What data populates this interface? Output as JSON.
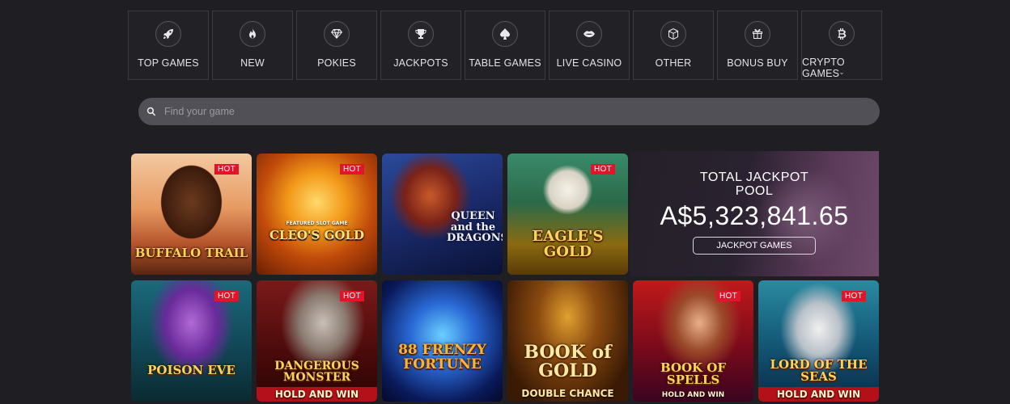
{
  "categories": [
    {
      "label": "TOP GAMES",
      "icon": "rocket-icon"
    },
    {
      "label": "NEW",
      "icon": "flame-icon"
    },
    {
      "label": "POKIES",
      "icon": "diamond-icon"
    },
    {
      "label": "JACKPOTS",
      "icon": "trophy-icon"
    },
    {
      "label": "TABLE GAMES",
      "icon": "spade-icon"
    },
    {
      "label": "LIVE CASINO",
      "icon": "lips-icon"
    },
    {
      "label": "OTHER",
      "icon": "cube-icon"
    },
    {
      "label": "BONUS BUY",
      "icon": "gift-icon"
    },
    {
      "label": "CRYPTO GAMES",
      "icon": "bitcoin-icon",
      "chevron": "⌄"
    }
  ],
  "search": {
    "placeholder": "Find your game"
  },
  "games": [
    {
      "title": "BUFFALO TRAIL",
      "subtitle": "",
      "hot": "HOT"
    },
    {
      "title": "CLEO'S GOLD",
      "subtitle": "FEATURED SLOT GAME",
      "hot": "HOT"
    },
    {
      "title": "QUEEN and the DRAGONS",
      "subtitle": "",
      "hot": ""
    },
    {
      "title": "EAGLE'S GOLD",
      "subtitle": "",
      "hot": "HOT"
    },
    {
      "title": "POISON EVE",
      "subtitle": "",
      "hot": "HOT"
    },
    {
      "title": "DANGEROUS MONSTER",
      "subtitle": "HOLD AND WIN",
      "hot": "HOT"
    },
    {
      "title": "88 FRENZY FORTUNE",
      "subtitle": "",
      "hot": ""
    },
    {
      "title": "BOOK of GOLD",
      "subtitle": "DOUBLE CHANCE",
      "hot": ""
    },
    {
      "title": "BOOK OF SPELLS",
      "subtitle": "HOLD AND WIN",
      "hot": "HOT"
    },
    {
      "title": "LORD OF THE SEAS",
      "subtitle": "HOLD AND WIN",
      "hot": "HOT"
    }
  ],
  "jackpot": {
    "title_line1": "TOTAL JACKPOT",
    "title_line2": "POOL",
    "amount": "A$5,323,841.65",
    "button": "JACKPOT GAMES"
  }
}
